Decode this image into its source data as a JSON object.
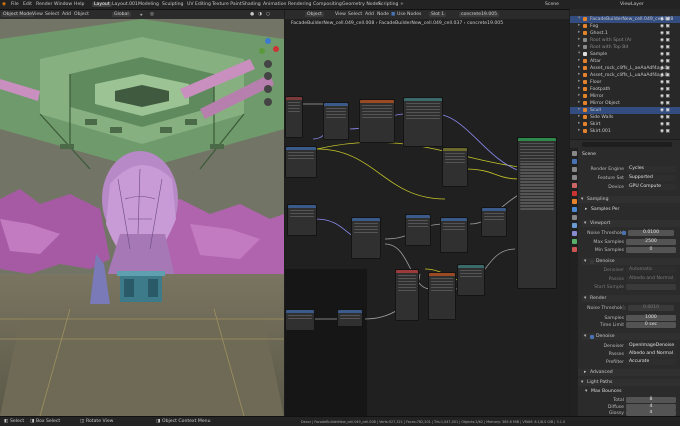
{
  "topbar": {
    "menus": [
      "File",
      "Edit",
      "Render",
      "Window",
      "Help"
    ],
    "workspaces": [
      "Layout",
      "Layout.001",
      "Modeling",
      "Sculpting",
      "UV Editing",
      "Texture Paint",
      "Shading",
      "Animation",
      "Rendering",
      "Compositing",
      "Geometry Nodes",
      "Scripting"
    ],
    "active_workspace": "Layout",
    "scene": "Scene",
    "view_layer": "ViewLayer"
  },
  "viewport_header": {
    "mode": "Object Mode",
    "menus": [
      "View",
      "Select",
      "Add",
      "Object"
    ],
    "transform": "Global"
  },
  "node_header": {
    "editor_type": "Object",
    "menus": [
      "View",
      "Select",
      "Add",
      "Node"
    ],
    "use_nodes": "Use Nodes",
    "slot": "Slot 1",
    "material": "concrete19.005"
  },
  "node_breadcrumb": {
    "items": [
      "FacadeBuilderNew_cell.049_cell.008",
      "FacadeBuilderNew_cell.049_cell.037",
      "concrete19.005"
    ]
  },
  "outliner": {
    "items": [
      {
        "label": "FacadeBuilderNew_cell.049_cell.008",
        "selected": true
      },
      {
        "label": "Fog",
        "selected": false
      },
      {
        "label": "Ghost.1",
        "selected": false
      },
      {
        "label": "Root with Spot (Ar",
        "selected": false
      },
      {
        "label": "Root with Top Bd",
        "selected": false
      },
      {
        "label": "Sample",
        "selected": false
      },
      {
        "label": "Altar",
        "selected": false
      },
      {
        "label": "Asset_rock_cliffs_L_aeAaAdf4a_LC",
        "selected": false
      },
      {
        "label": "Asset_rock_cliffs_L_uaAaAdf4a_LC",
        "selected": false
      },
      {
        "label": "Floor",
        "selected": false
      },
      {
        "label": "Footpath",
        "selected": false
      },
      {
        "label": "Mirror",
        "selected": false
      },
      {
        "label": "Mirror Object",
        "selected": false
      },
      {
        "label": "Scull",
        "selected": true
      },
      {
        "label": "Side Walls",
        "selected": false
      },
      {
        "label": "Skirt",
        "selected": false
      },
      {
        "label": "Skirt.001",
        "selected": false
      }
    ]
  },
  "properties": {
    "context": "Scene",
    "render_engine_label": "Render Engine",
    "render_engine": "Cycles",
    "feature_set_label": "Feature Set",
    "feature_set": "Supported",
    "device_label": "Device",
    "device": "GPU Compute",
    "sampling": "Sampling",
    "samples_per": "Samples Per",
    "viewport": "Viewport",
    "noise_threshold_label": "Noise Threshold",
    "noise_threshold": "0.0100",
    "max_samples_label": "Max Samples",
    "max_samples": "2500",
    "min_samples_label": "Min Samples",
    "min_samples": "0",
    "denoise": "Denoise",
    "denoiser_label": "Denoiser",
    "denoiser": "Automatic",
    "passes_label": "Passes",
    "passes": "Albedo and Normal",
    "start_sample_label": "Start Sample",
    "render": "Render",
    "render_noise_label": "Noise Threshold",
    "render_noise": "0.0010",
    "samples_label": "Samples",
    "samples": "1000",
    "time_limit_label": "Time Limit",
    "time_limit": "0 sec",
    "denoise2": "Denoise",
    "denoiser2_label": "Denoiser",
    "denoiser2": "OpenImageDenoise",
    "passes2_label": "Passes",
    "passes2": "Albedo and Normal",
    "prefilter_label": "Prefilter",
    "prefilter": "Accurate",
    "advanced": "Advanced",
    "light_paths": "Light Paths",
    "max_bounces": "Max Bounces",
    "total_label": "Total",
    "total": "8",
    "diffuse_label": "Diffuse",
    "diffuse": "4",
    "glossy_label": "Glossy",
    "glossy": "4"
  },
  "statusbar": {
    "select": "Select",
    "box_select": "Box Select",
    "rotate_view": "Rotate View",
    "context_menu": "Object Context Menu",
    "stats": "Decor | FacadeBuilderNew_cell.049_cell.008 | Verts:527,321 | Faces:782,201 | Tris:1,047,001 | Objects:2/62 | Memory: 385.6 MiB | VRAM: 6.1/8.0 GiB | 3.1.0"
  },
  "colors": {
    "accent": "#4772b3",
    "selection": "#334d80",
    "viewport_bg": "#6e7163",
    "node_bg": "#202020"
  }
}
